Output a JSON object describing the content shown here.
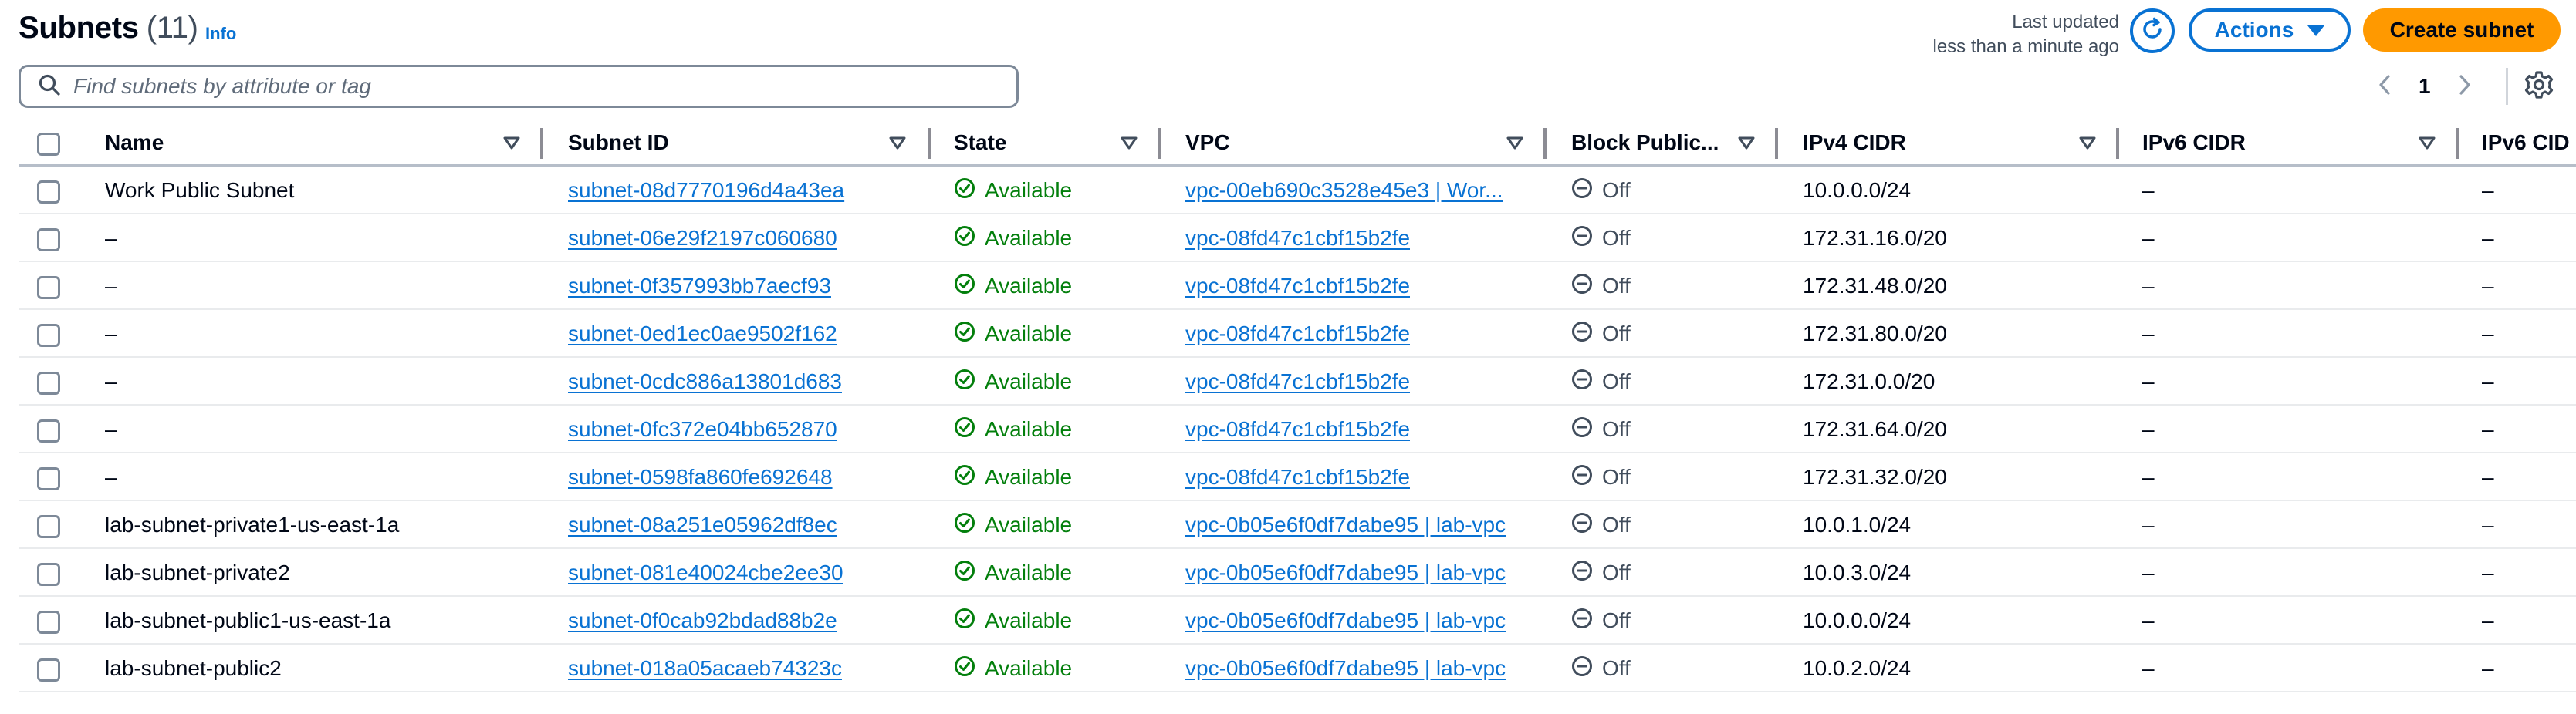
{
  "header": {
    "title": "Subnets",
    "count": "(11)",
    "info_label": "Info",
    "last_updated_line1": "Last updated",
    "last_updated_line2": "less than a minute ago",
    "actions_label": "Actions",
    "create_label": "Create subnet"
  },
  "search": {
    "placeholder": "Find subnets by attribute or tag"
  },
  "pagination": {
    "current_page": "1"
  },
  "columns": [
    {
      "label": "Name"
    },
    {
      "label": "Subnet ID"
    },
    {
      "label": "State"
    },
    {
      "label": "VPC"
    },
    {
      "label": "Block Public..."
    },
    {
      "label": "IPv4 CIDR"
    },
    {
      "label": "IPv6 CIDR"
    },
    {
      "label": "IPv6 CID"
    }
  ],
  "rows": [
    {
      "name": "Work Public Subnet",
      "subnet_id": "subnet-08d7770196d4a43ea",
      "state": "Available",
      "vpc": "vpc-00eb690c3528e45e3 | Wor...",
      "block": "Off",
      "ipv4": "10.0.0.0/24",
      "ipv6": "–",
      "ipv6b": "–"
    },
    {
      "name": "–",
      "subnet_id": "subnet-06e29f2197c060680",
      "state": "Available",
      "vpc": "vpc-08fd47c1cbf15b2fe",
      "block": "Off",
      "ipv4": "172.31.16.0/20",
      "ipv6": "–",
      "ipv6b": "–"
    },
    {
      "name": "–",
      "subnet_id": "subnet-0f357993bb7aecf93",
      "state": "Available",
      "vpc": "vpc-08fd47c1cbf15b2fe",
      "block": "Off",
      "ipv4": "172.31.48.0/20",
      "ipv6": "–",
      "ipv6b": "–"
    },
    {
      "name": "–",
      "subnet_id": "subnet-0ed1ec0ae9502f162",
      "state": "Available",
      "vpc": "vpc-08fd47c1cbf15b2fe",
      "block": "Off",
      "ipv4": "172.31.80.0/20",
      "ipv6": "–",
      "ipv6b": "–"
    },
    {
      "name": "–",
      "subnet_id": "subnet-0cdc886a13801d683",
      "state": "Available",
      "vpc": "vpc-08fd47c1cbf15b2fe",
      "block": "Off",
      "ipv4": "172.31.0.0/20",
      "ipv6": "–",
      "ipv6b": "–"
    },
    {
      "name": "–",
      "subnet_id": "subnet-0fc372e04bb652870",
      "state": "Available",
      "vpc": "vpc-08fd47c1cbf15b2fe",
      "block": "Off",
      "ipv4": "172.31.64.0/20",
      "ipv6": "–",
      "ipv6b": "–"
    },
    {
      "name": "–",
      "subnet_id": "subnet-0598fa860fe692648",
      "state": "Available",
      "vpc": "vpc-08fd47c1cbf15b2fe",
      "block": "Off",
      "ipv4": "172.31.32.0/20",
      "ipv6": "–",
      "ipv6b": "–"
    },
    {
      "name": "lab-subnet-private1-us-east-1a",
      "subnet_id": "subnet-08a251e05962df8ec",
      "state": "Available",
      "vpc": "vpc-0b05e6f0df7dabe95 | lab-vpc",
      "block": "Off",
      "ipv4": "10.0.1.0/24",
      "ipv6": "–",
      "ipv6b": "–"
    },
    {
      "name": "lab-subnet-private2",
      "subnet_id": "subnet-081e40024cbe2ee30",
      "state": "Available",
      "vpc": "vpc-0b05e6f0df7dabe95 | lab-vpc",
      "block": "Off",
      "ipv4": "10.0.3.0/24",
      "ipv6": "–",
      "ipv6b": "–"
    },
    {
      "name": "lab-subnet-public1-us-east-1a",
      "subnet_id": "subnet-0f0cab92bdad88b2e",
      "state": "Available",
      "vpc": "vpc-0b05e6f0df7dabe95 | lab-vpc",
      "block": "Off",
      "ipv4": "10.0.0.0/24",
      "ipv6": "–",
      "ipv6b": "–"
    },
    {
      "name": "lab-subnet-public2",
      "subnet_id": "subnet-018a05acaeb74323c",
      "state": "Available",
      "vpc": "vpc-0b05e6f0df7dabe95 | lab-vpc",
      "block": "Off",
      "ipv4": "10.0.2.0/24",
      "ipv6": "–",
      "ipv6b": "–"
    }
  ],
  "colors": {
    "link": "#0972d3",
    "primary_button": "#ff9900",
    "status_success": "#037f0c",
    "status_off": "#414d5c"
  }
}
